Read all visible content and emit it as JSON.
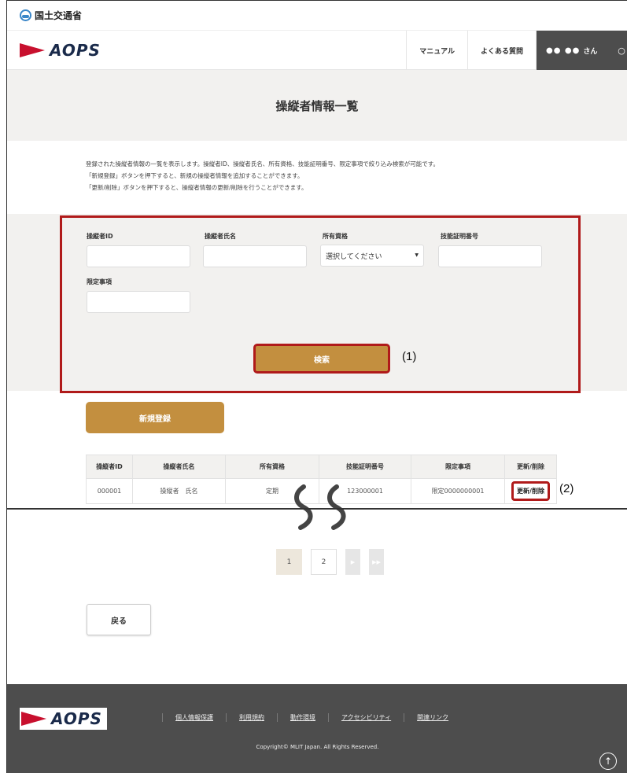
{
  "gov": {
    "name": "国土交通省"
  },
  "header": {
    "logo_text": "AOPS",
    "nav": {
      "manual": "マニュアル",
      "faq": "よくある質問",
      "user_dots": "●● ●●",
      "user_suffix": "さん"
    }
  },
  "page": {
    "title": "操縦者情報一覧",
    "description": [
      "登録された操縦者情報の一覧を表示します。操縦者ID、操縦者氏名、所有資格、技能証明番号、限定事項で絞り込み検索が可能です。",
      "「新規登録」ボタンを押下すると、新規の操縦者情報を追加することができます。",
      "「更新/削除」ボタンを押下すると、操縦者情報の更新/削除を行うことができます。"
    ]
  },
  "search": {
    "labels": {
      "pilot_id": "操縦者ID",
      "pilot_name": "操縦者氏名",
      "qualification": "所有資格",
      "cert_no": "技能証明番号",
      "restriction": "限定事項"
    },
    "qualification_select": {
      "selected": "選択してください"
    },
    "button": "検索",
    "callout": "(1)"
  },
  "actions": {
    "new_button": "新規登録"
  },
  "table": {
    "headers": [
      "操縦者ID",
      "操縦者氏名",
      "所有資格",
      "技能証明番号",
      "限定事項",
      "更新/削除"
    ],
    "rows": [
      {
        "id": "000001",
        "name": "操縦者　氏名",
        "qualification": "定期",
        "cert_no": "123000001",
        "restriction": "限定0000000001",
        "action": "更新/削除"
      }
    ],
    "callout": "(2)"
  },
  "pager": {
    "pages": [
      "1",
      "2"
    ],
    "next": "▶",
    "last": "▶▶"
  },
  "back_button": "戻る",
  "footer": {
    "logo_text": "AOPS",
    "links": [
      "個人情報保護",
      "利用規約",
      "動作環境",
      "アクセシビリティ",
      "関連リンク"
    ],
    "copyright": "Copyright© MLIT Japan. All Rights Reserved."
  },
  "colors": {
    "accent_gold": "#c38f3f",
    "highlight_red": "#b01a1a",
    "band_gray": "#f2f1ef",
    "footer_gray": "#4d4d4d",
    "logo_red": "#c8102e"
  }
}
